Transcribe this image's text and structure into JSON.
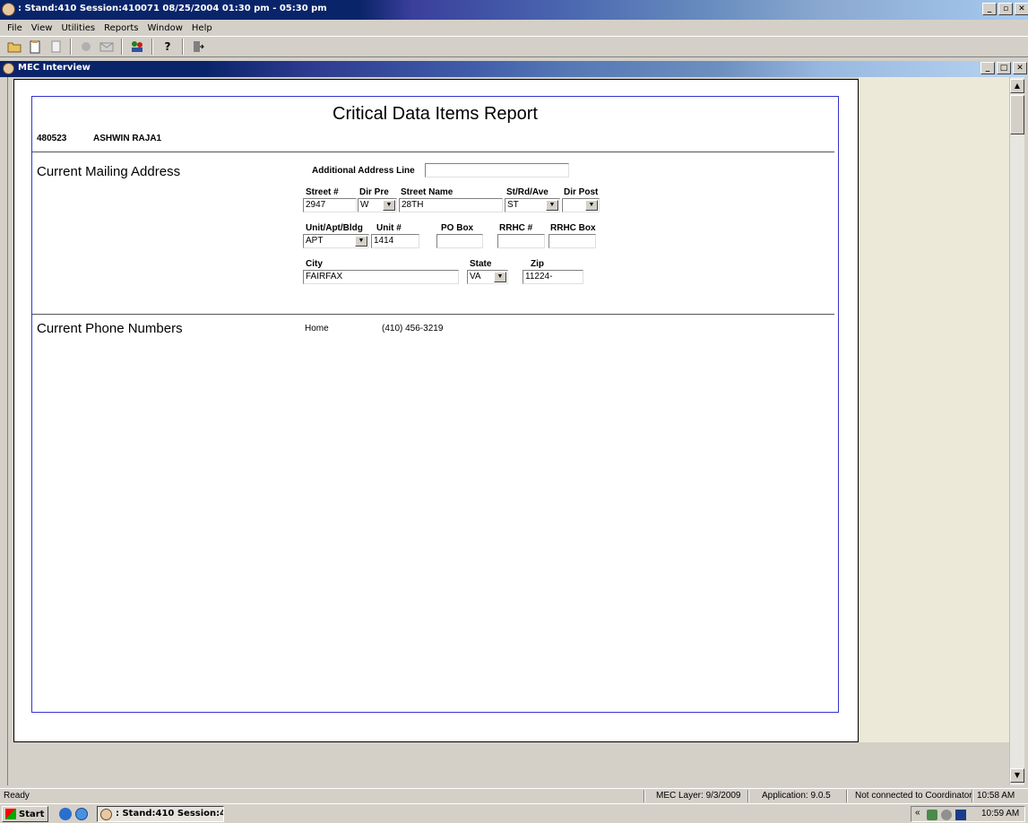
{
  "app": {
    "title": ": Stand:410 Session:410071 08/25/2004 01:30 pm - 05:30 pm",
    "menu": [
      "File",
      "View",
      "Utilities",
      "Reports",
      "Window",
      "Help"
    ]
  },
  "toolbar": {
    "icons": [
      "folder-open-icon",
      "clipboard-icon",
      "document-icon",
      "stop-icon",
      "mail-icon",
      "people-icon",
      "help-icon",
      "exit-icon"
    ]
  },
  "mdi": {
    "title": "MEC Interview"
  },
  "report": {
    "title": "Critical Data Items Report",
    "patient_id": "480523",
    "patient_name": "ASHWIN  RAJA1",
    "mailing": {
      "heading": "Current Mailing Address",
      "additional_line_label": "Additional Address Line",
      "additional_line_value": "",
      "street_no_label": "Street #",
      "street_no": "2947",
      "dir_pre_label": "Dir Pre",
      "dir_pre": "W",
      "street_name_label": "Street Name",
      "street_name": "28TH",
      "st_rd_ave_label": "St/Rd/Ave",
      "st_rd_ave": "ST",
      "dir_post_label": "Dir Post",
      "dir_post": "",
      "unit_type_label": "Unit/Apt/Bldg",
      "unit_type": "APT",
      "unit_no_label": "Unit #",
      "unit_no": "1414",
      "po_box_label": "PO Box",
      "po_box": "",
      "rrhc_no_label": "RRHC #",
      "rrhc_no": "",
      "rrhc_box_label": "RRHC Box",
      "rrhc_box": "",
      "city_label": "City",
      "city": "FAIRFAX",
      "state_label": "State",
      "state": "VA",
      "zip_label": "Zip",
      "zip": "11224-"
    },
    "phone": {
      "heading": "Current Phone Numbers",
      "type": "Home",
      "number": "(410) 456-3219"
    }
  },
  "status": {
    "ready": "Ready",
    "mec_layer": "MEC Layer: 9/3/2009",
    "application": "Application: 9.0.5",
    "coordinator": "Not connected to Coordinator",
    "time": "10:58 AM"
  },
  "taskbar": {
    "start": "Start",
    "task": ": Stand:410 Session:4...",
    "tray_chevron": "«",
    "clock": "10:59 AM"
  }
}
